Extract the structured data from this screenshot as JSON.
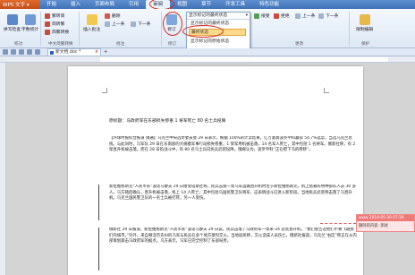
{
  "app": {
    "name": "WPS 文字 ▾"
  },
  "menu": {
    "tabs": [
      "开始",
      "插入",
      "页面布局",
      "引用",
      "审阅",
      "视图",
      "章节",
      "开发工具",
      "特色功能"
    ],
    "active_index": 4
  },
  "ribbon": {
    "groups": [
      "校对",
      "中文简繁转换",
      "批注",
      "修订",
      "更改",
      "保护"
    ],
    "buttons": {
      "spell": "拼写检查",
      "count": "字数统计",
      "to_simplified": "繁转简",
      "to_traditional": "简转繁",
      "convert": "简繁转换",
      "insert_comment": "插入批注",
      "delete": "删除",
      "prev": "上一条",
      "next": "下一条",
      "track": "修订",
      "accept": "接受",
      "reject": "拒绝",
      "prev2": "上一条",
      "next2": "下一条",
      "restrict": "限制编辑"
    }
  },
  "dropdown": {
    "current": "显示标记的最终状态",
    "items": [
      "显示标记的最终状态",
      "最终状态",
      "显示标记的原始状态",
      "原始状态"
    ],
    "selected_index": 1
  },
  "doc_tab": {
    "name": "新文档.doc *",
    "new_tab": "+"
  },
  "document": {
    "title_line": "原标题：乌政府军在东部损失惨重 1 将军死亡 80 名士兵投降",
    "paragraphs": [
      "【环球时报综合报道 锡通】乌克兰中央选举委员会 29 日表示，根据 100%的计票结果，亿万富翁波罗申科赢得 54.7%选票，当选乌克兰总统。与此同时，乌军队 29 日在东南部的大规模军事行动损失惨重，1 架军用机被击落，14 名军人死亡，其中包括 1 名将军。俄新社称，有 2 架直升机被击落。而在 28 日的战斗中，有 80 名乌士兵向民兵武装投降。俄媒认为，波罗申科“正在把下马的转移”。",
      "新拉维扬斯克“人民市长”波诺马廖夫 29 日接受塔斯社称，民兵击毁一架乌军运输直升机时位于斯拉维扬斯克，机上搭载有特种部队人员 30 多人。乌方随后确认，直升机被击落，机上 14 人死亡，其中包括乌国民警卫队将军，这表明战斗已进入新阶段。当地民兵武装称击落了乌直升机。乌克兰国民警卫队的一名士兵被打死，另一人受伤。",
      "俄新社 29 日报道，新拉维扬斯克“人民市长”波诺马廖夫 29 日说，民兵击落了乌政府军一架米-24 武装直升机，“我们警告过他们不要飞越我们的城市。”另外，来自顿涅茨克州的乌军与民兵在多个地方激烈交火。当地居民称，交火造成人员伤亡。俄新社报道，乌克兰“右区”称正在从内部策划袭击乌政府军的据点。乌方表示，乌军已完全控制了东部局势。"
    ]
  },
  "comment": {
    "header": "www 2014-05-30 07:29",
    "body": "删除的内容: 测试"
  }
}
